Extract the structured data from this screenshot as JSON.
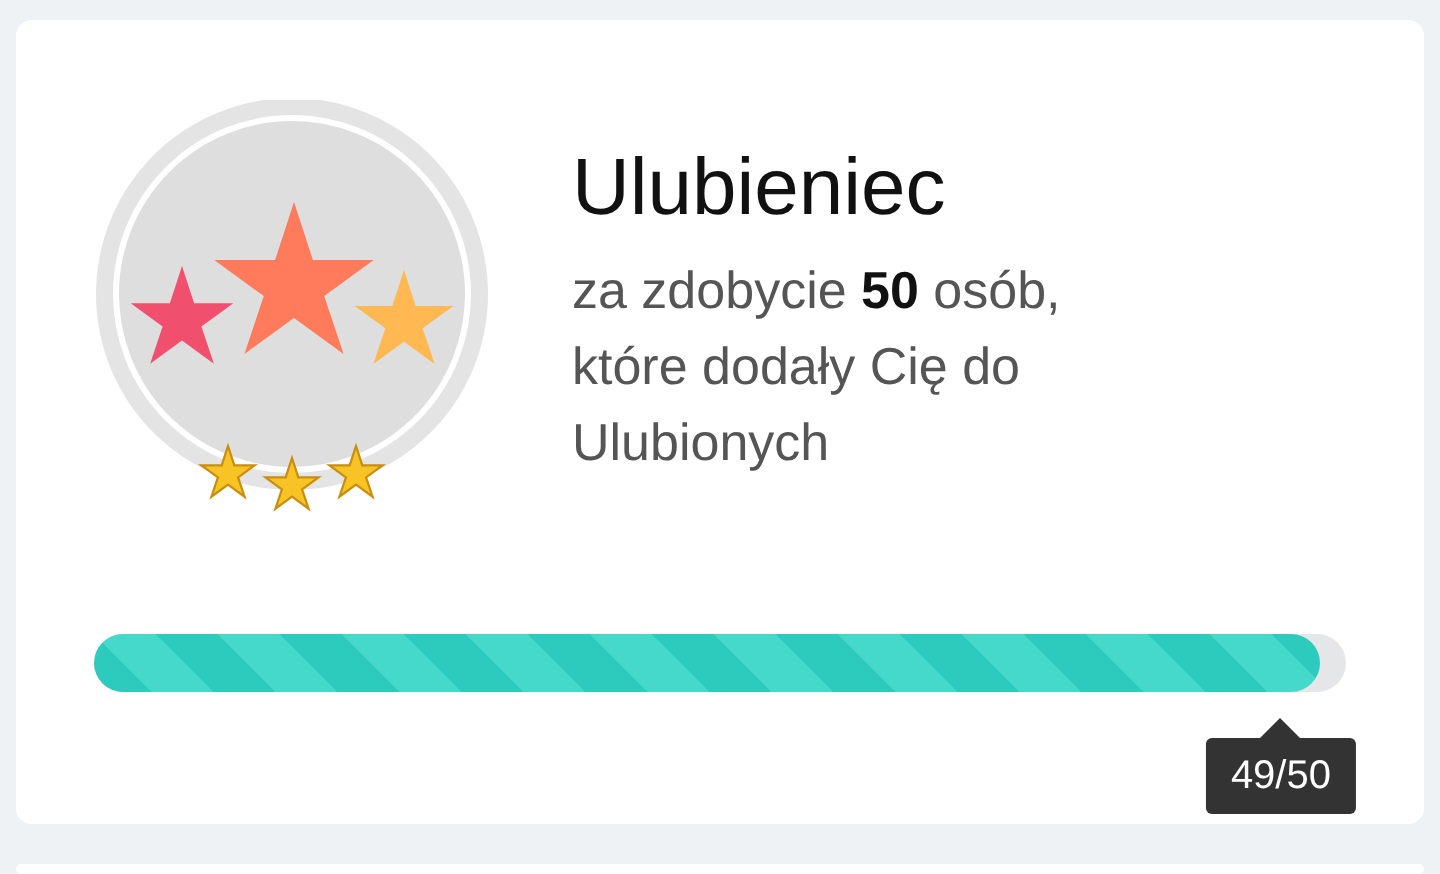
{
  "achievement": {
    "title": "Ulubieniec",
    "description": "za zdobycie **50** osób, które dodały Cię do Ulubionych",
    "stars": 3
  },
  "progress": {
    "level": 0.98,
    "reading": "49/50"
  }
}
